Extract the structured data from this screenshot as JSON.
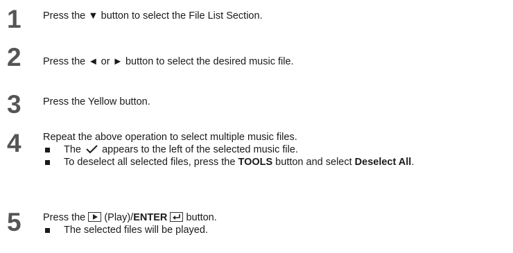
{
  "steps": [
    {
      "number": "1",
      "text": "Press the ▼ button to select the File List Section."
    },
    {
      "number": "2",
      "text": "Press the ◄ or ► button to select the desired music file."
    },
    {
      "number": "3",
      "text": "Press the Yellow button."
    },
    {
      "number": "4",
      "text": "Repeat the above operation to select multiple music files.",
      "bullet1": {
        "pre": "The",
        "post": "appears to the left of the selected music file."
      },
      "bullet2": {
        "pre": "To deselect all selected files, press the ",
        "tools": "TOOLS",
        "mid": " button and select ",
        "deselect": "Deselect All",
        "end": "."
      }
    },
    {
      "number": "5",
      "pre": "Press the",
      "play": "(Play)/",
      "enter": "ENTER",
      "post": "button.",
      "bullet1": "The selected files will be played."
    }
  ]
}
